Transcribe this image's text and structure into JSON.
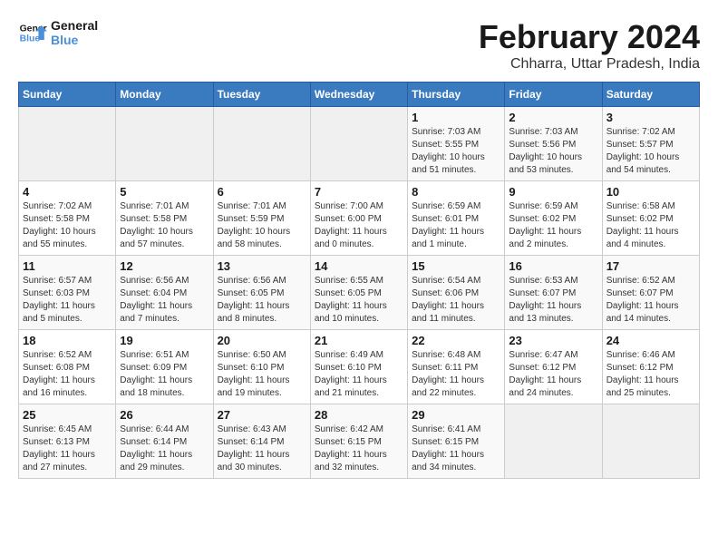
{
  "header": {
    "logo_line1": "General",
    "logo_line2": "Blue",
    "title": "February 2024",
    "subtitle": "Chharra, Uttar Pradesh, India"
  },
  "calendar": {
    "days_of_week": [
      "Sunday",
      "Monday",
      "Tuesday",
      "Wednesday",
      "Thursday",
      "Friday",
      "Saturday"
    ],
    "weeks": [
      [
        {
          "day": "",
          "info": ""
        },
        {
          "day": "",
          "info": ""
        },
        {
          "day": "",
          "info": ""
        },
        {
          "day": "",
          "info": ""
        },
        {
          "day": "1",
          "info": "Sunrise: 7:03 AM\nSunset: 5:55 PM\nDaylight: 10 hours and 51 minutes."
        },
        {
          "day": "2",
          "info": "Sunrise: 7:03 AM\nSunset: 5:56 PM\nDaylight: 10 hours and 53 minutes."
        },
        {
          "day": "3",
          "info": "Sunrise: 7:02 AM\nSunset: 5:57 PM\nDaylight: 10 hours and 54 minutes."
        }
      ],
      [
        {
          "day": "4",
          "info": "Sunrise: 7:02 AM\nSunset: 5:58 PM\nDaylight: 10 hours and 55 minutes."
        },
        {
          "day": "5",
          "info": "Sunrise: 7:01 AM\nSunset: 5:58 PM\nDaylight: 10 hours and 57 minutes."
        },
        {
          "day": "6",
          "info": "Sunrise: 7:01 AM\nSunset: 5:59 PM\nDaylight: 10 hours and 58 minutes."
        },
        {
          "day": "7",
          "info": "Sunrise: 7:00 AM\nSunset: 6:00 PM\nDaylight: 11 hours and 0 minutes."
        },
        {
          "day": "8",
          "info": "Sunrise: 6:59 AM\nSunset: 6:01 PM\nDaylight: 11 hours and 1 minute."
        },
        {
          "day": "9",
          "info": "Sunrise: 6:59 AM\nSunset: 6:02 PM\nDaylight: 11 hours and 2 minutes."
        },
        {
          "day": "10",
          "info": "Sunrise: 6:58 AM\nSunset: 6:02 PM\nDaylight: 11 hours and 4 minutes."
        }
      ],
      [
        {
          "day": "11",
          "info": "Sunrise: 6:57 AM\nSunset: 6:03 PM\nDaylight: 11 hours and 5 minutes."
        },
        {
          "day": "12",
          "info": "Sunrise: 6:56 AM\nSunset: 6:04 PM\nDaylight: 11 hours and 7 minutes."
        },
        {
          "day": "13",
          "info": "Sunrise: 6:56 AM\nSunset: 6:05 PM\nDaylight: 11 hours and 8 minutes."
        },
        {
          "day": "14",
          "info": "Sunrise: 6:55 AM\nSunset: 6:05 PM\nDaylight: 11 hours and 10 minutes."
        },
        {
          "day": "15",
          "info": "Sunrise: 6:54 AM\nSunset: 6:06 PM\nDaylight: 11 hours and 11 minutes."
        },
        {
          "day": "16",
          "info": "Sunrise: 6:53 AM\nSunset: 6:07 PM\nDaylight: 11 hours and 13 minutes."
        },
        {
          "day": "17",
          "info": "Sunrise: 6:52 AM\nSunset: 6:07 PM\nDaylight: 11 hours and 14 minutes."
        }
      ],
      [
        {
          "day": "18",
          "info": "Sunrise: 6:52 AM\nSunset: 6:08 PM\nDaylight: 11 hours and 16 minutes."
        },
        {
          "day": "19",
          "info": "Sunrise: 6:51 AM\nSunset: 6:09 PM\nDaylight: 11 hours and 18 minutes."
        },
        {
          "day": "20",
          "info": "Sunrise: 6:50 AM\nSunset: 6:10 PM\nDaylight: 11 hours and 19 minutes."
        },
        {
          "day": "21",
          "info": "Sunrise: 6:49 AM\nSunset: 6:10 PM\nDaylight: 11 hours and 21 minutes."
        },
        {
          "day": "22",
          "info": "Sunrise: 6:48 AM\nSunset: 6:11 PM\nDaylight: 11 hours and 22 minutes."
        },
        {
          "day": "23",
          "info": "Sunrise: 6:47 AM\nSunset: 6:12 PM\nDaylight: 11 hours and 24 minutes."
        },
        {
          "day": "24",
          "info": "Sunrise: 6:46 AM\nSunset: 6:12 PM\nDaylight: 11 hours and 25 minutes."
        }
      ],
      [
        {
          "day": "25",
          "info": "Sunrise: 6:45 AM\nSunset: 6:13 PM\nDaylight: 11 hours and 27 minutes."
        },
        {
          "day": "26",
          "info": "Sunrise: 6:44 AM\nSunset: 6:14 PM\nDaylight: 11 hours and 29 minutes."
        },
        {
          "day": "27",
          "info": "Sunrise: 6:43 AM\nSunset: 6:14 PM\nDaylight: 11 hours and 30 minutes."
        },
        {
          "day": "28",
          "info": "Sunrise: 6:42 AM\nSunset: 6:15 PM\nDaylight: 11 hours and 32 minutes."
        },
        {
          "day": "29",
          "info": "Sunrise: 6:41 AM\nSunset: 6:15 PM\nDaylight: 11 hours and 34 minutes."
        },
        {
          "day": "",
          "info": ""
        },
        {
          "day": "",
          "info": ""
        }
      ]
    ]
  }
}
